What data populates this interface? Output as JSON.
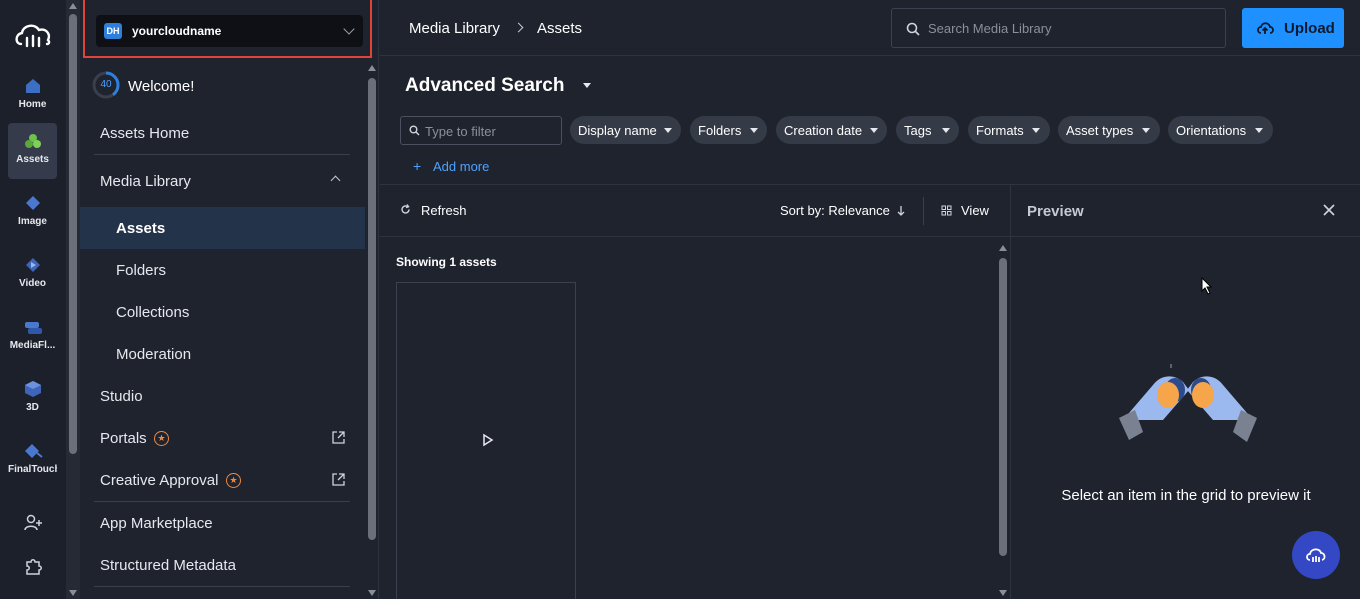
{
  "rail": {
    "items": [
      {
        "label": "Home",
        "icon": "home-icon"
      },
      {
        "label": "Assets",
        "icon": "assets-icon",
        "active": true
      },
      {
        "label": "Image",
        "icon": "image-icon"
      },
      {
        "label": "Video",
        "icon": "video-icon"
      },
      {
        "label": "MediaFl...",
        "icon": "mediaflows-icon"
      },
      {
        "label": "3D",
        "icon": "cube-icon"
      },
      {
        "label": "FinalTouch",
        "icon": "finaltouch-icon"
      }
    ],
    "bottom_icons": [
      "add-user-icon",
      "puzzle-icon"
    ]
  },
  "cloud": {
    "badge": "DH",
    "name": "yourcloudname"
  },
  "welcome": {
    "progress": "40",
    "label": "Welcome!"
  },
  "sidebar": {
    "assets_home": "Assets Home",
    "media_library": "Media Library",
    "assets": "Assets",
    "folders": "Folders",
    "collections": "Collections",
    "moderation": "Moderation",
    "studio": "Studio",
    "portals": "Portals",
    "creative_approval": "Creative Approval",
    "app_marketplace": "App Marketplace",
    "structured_metadata": "Structured Metadata"
  },
  "header": {
    "breadcrumb": [
      "Media Library",
      "Assets"
    ],
    "search_placeholder": "Search Media Library",
    "upload_label": "Upload"
  },
  "search": {
    "title": "Advanced Search",
    "filter_placeholder": "Type to filter",
    "chips": [
      "Display name",
      "Folders",
      "Creation date",
      "Tags",
      "Formats",
      "Asset types",
      "Orientations"
    ],
    "add_more": "Add more"
  },
  "toolbar": {
    "refresh": "Refresh",
    "sort": "Sort by: Relevance",
    "view": "View"
  },
  "grid": {
    "showing": "Showing 1 assets"
  },
  "preview": {
    "title": "Preview",
    "empty_message": "Select an item in the grid to preview it"
  },
  "colors": {
    "accent": "#1e90ff",
    "highlight_border": "#e0433c",
    "star": "#f0883e",
    "fab": "#3448c5"
  }
}
